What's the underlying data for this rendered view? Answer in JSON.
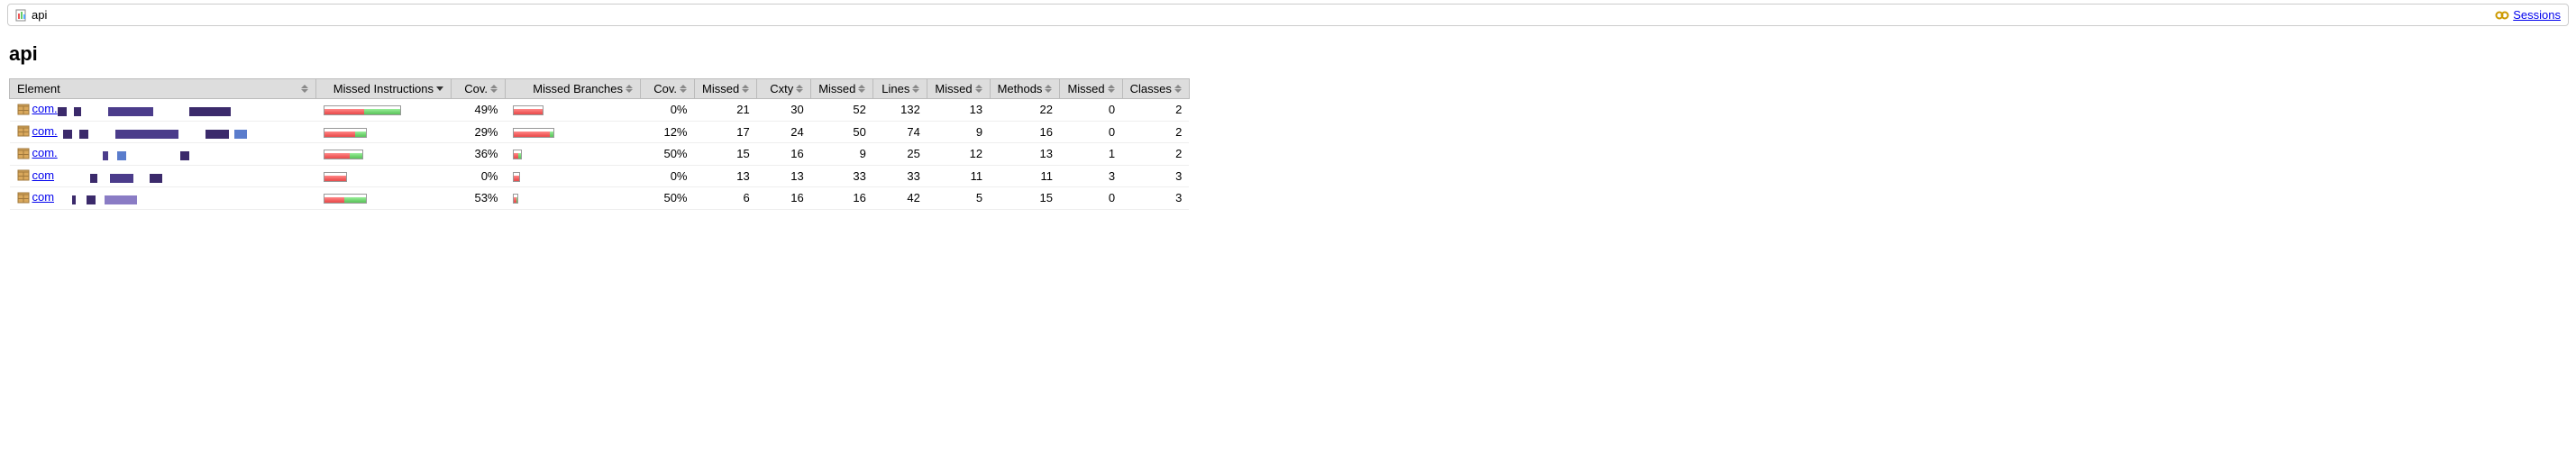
{
  "breadcrumb": {
    "title": "api",
    "sessions_label": "Sessions"
  },
  "page_title": "api",
  "headers": {
    "element": "Element",
    "missed_instr": "Missed Instructions",
    "cov1": "Cov.",
    "missed_branches": "Missed Branches",
    "cov2": "Cov.",
    "missed1": "Missed",
    "cxty": "Cxty",
    "missed2": "Missed",
    "lines": "Lines",
    "missed3": "Missed",
    "methods": "Methods",
    "missed4": "Missed",
    "classes": "Classes"
  },
  "rows": [
    {
      "pkg_prefix": "com.",
      "instr_bar": {
        "total": 86,
        "red": 44,
        "green": 42
      },
      "instr_cov": "49%",
      "branch_bar": {
        "total": 34,
        "red": 34,
        "green": 0
      },
      "branch_cov": "0%",
      "missed1": "21",
      "cxty": "30",
      "missed2": "52",
      "lines": "132",
      "missed3": "13",
      "methods": "22",
      "missed4": "0",
      "classes": "2"
    },
    {
      "pkg_prefix": "com.",
      "instr_bar": {
        "total": 48,
        "red": 34,
        "green": 14
      },
      "instr_cov": "29%",
      "branch_bar": {
        "total": 46,
        "red": 40,
        "green": 6
      },
      "branch_cov": "12%",
      "missed1": "17",
      "cxty": "24",
      "missed2": "50",
      "lines": "74",
      "missed3": "9",
      "methods": "16",
      "missed4": "0",
      "classes": "2"
    },
    {
      "pkg_prefix": "com.",
      "instr_bar": {
        "total": 44,
        "red": 28,
        "green": 16
      },
      "instr_cov": "36%",
      "branch_bar": {
        "total": 10,
        "red": 5,
        "green": 5
      },
      "branch_cov": "50%",
      "missed1": "15",
      "cxty": "16",
      "missed2": "9",
      "lines": "25",
      "missed3": "12",
      "methods": "13",
      "missed4": "1",
      "classes": "2"
    },
    {
      "pkg_prefix": "com",
      "instr_bar": {
        "total": 26,
        "red": 26,
        "green": 0
      },
      "instr_cov": "0%",
      "branch_bar": {
        "total": 8,
        "red": 8,
        "green": 0
      },
      "branch_cov": "0%",
      "missed1": "13",
      "cxty": "13",
      "missed2": "33",
      "lines": "33",
      "missed3": "11",
      "methods": "11",
      "missed4": "3",
      "classes": "3"
    },
    {
      "pkg_prefix": "com",
      "instr_bar": {
        "total": 48,
        "red": 22,
        "green": 26
      },
      "instr_cov": "53%",
      "branch_bar": {
        "total": 6,
        "red": 3,
        "green": 3
      },
      "branch_cov": "50%",
      "missed1": "6",
      "cxty": "16",
      "missed2": "16",
      "lines": "42",
      "missed3": "5",
      "methods": "15",
      "missed4": "0",
      "classes": "3"
    }
  ]
}
